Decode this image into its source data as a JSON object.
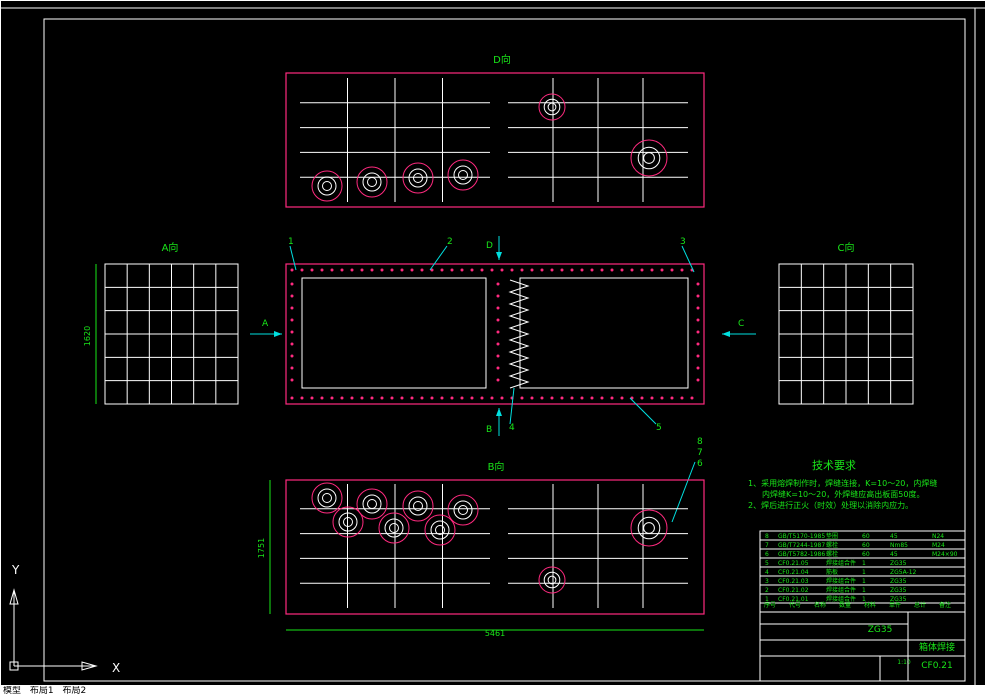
{
  "colors": {
    "background": "#000000",
    "frame": "#ffffff",
    "outline": "#ff2a7f",
    "annotation_text": "#19e619",
    "leader": "#00e0e0",
    "bolt": "#ff2a7f",
    "highlight": "#ffffff"
  },
  "views": {
    "d_view_label": "D向",
    "a_view_label": "A向",
    "c_view_label": "C向",
    "b_view_label": "B向"
  },
  "arrows": {
    "a": "A",
    "b": "B",
    "c": "C",
    "d": "D"
  },
  "balloons": [
    "1",
    "2",
    "3",
    "4",
    "5",
    "6",
    "7",
    "8"
  ],
  "dimensions": {
    "a_height": "1620",
    "b_height": "1751",
    "b_length": "5461"
  },
  "tech_requirements": {
    "title": "技术要求",
    "lines": [
      "1、采用熔焊制作时，焊缝连接，K=10～20，内焊缝",
      "内焊缝K=10～20，外焊缝应高出板面50度。",
      "2、焊后进行正火（时效）处理以消除内应力。"
    ]
  },
  "bom": {
    "rows": [
      [
        "8",
        "GB/T5170-1985",
        "垫圈",
        "60",
        "45",
        "N24"
      ],
      [
        "7",
        "GB/T7244-1987",
        "螺栓",
        "60",
        "Nm85",
        "M24"
      ],
      [
        "6",
        "GB/T5782-1986",
        "螺栓",
        "60",
        "45",
        "M24×90"
      ],
      [
        "5",
        "CF0.21.05",
        "焊接组合件",
        "1",
        "ZG35",
        ""
      ],
      [
        "4",
        "CF0.21.04",
        "筋板",
        "1",
        "ZG5A-12",
        ""
      ],
      [
        "3",
        "CF0.21.03",
        "焊接组合件",
        "1",
        "ZG35",
        ""
      ],
      [
        "2",
        "CF0.21.02",
        "焊接组合件",
        "1",
        "ZG35",
        ""
      ],
      [
        "1",
        "CF0.21.01",
        "焊接组合件",
        "1",
        "ZG35",
        ""
      ]
    ],
    "header": [
      "序号",
      "代号",
      "名称",
      "数量",
      "材料",
      "单件",
      "总计",
      "备注"
    ]
  },
  "title_block": {
    "material": "ZG35",
    "drawing_title": "箱体焊接",
    "drawing_number": "CF0.21",
    "scale": "1:10"
  },
  "ucs": {
    "x_label": "X",
    "y_label": "Y"
  },
  "tabs": [
    "模型",
    "布局1",
    "布局2"
  ]
}
